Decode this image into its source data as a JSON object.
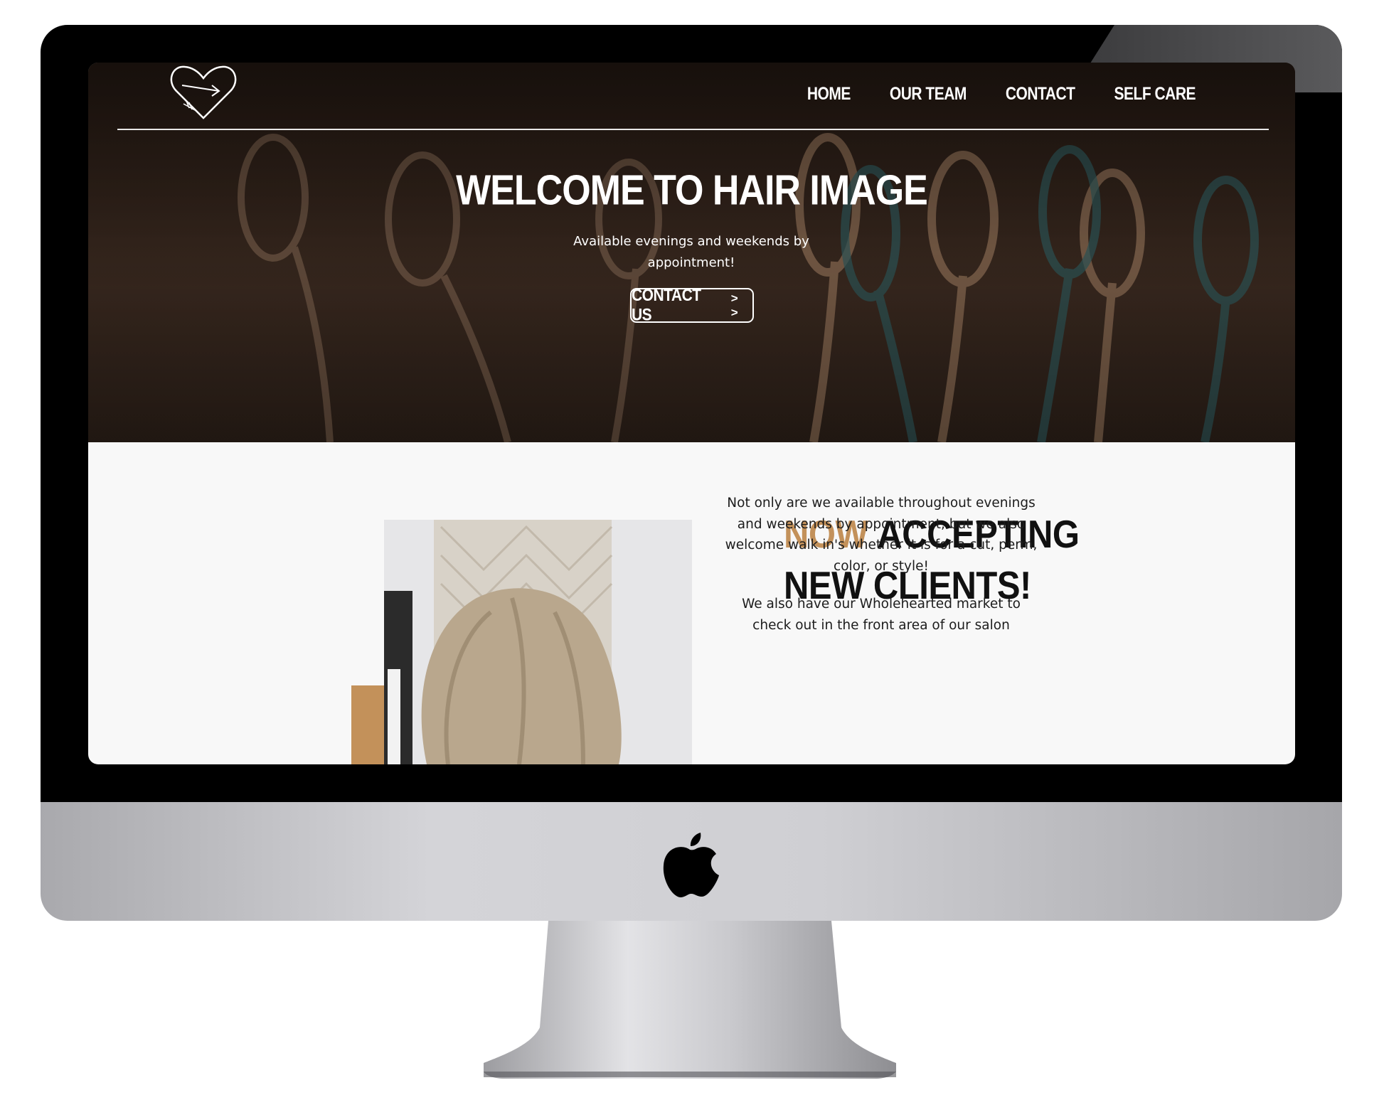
{
  "nav": {
    "items": [
      {
        "label": "HOME"
      },
      {
        "label": "OUR TEAM"
      },
      {
        "label": "CONTACT"
      },
      {
        "label": "SELF CARE"
      }
    ]
  },
  "hero": {
    "title": "WELCOME TO HAIR IMAGE",
    "subtitle": "Available evenings and weekends by appointment!",
    "cta_label": "CONTACT US",
    "cta_arrow": "> >"
  },
  "section": {
    "heading_accent": "NOW",
    "heading_rest": "ACCEPTING",
    "heading_line2": "NEW CLIENTS!",
    "paragraph1": "Not only are we available throughout evenings and weekends by appointment, but we also welcome walk in's whether it is for a cut, perm, color, or style!",
    "paragraph2": "We also have our Wholehearted market to check out in the front area of our salon"
  },
  "colors": {
    "accent": "#c3915a",
    "hero_overlay": "#2e221b",
    "page_bg": "#f8f8f8"
  },
  "icons": {
    "logo": "heart-arrow-logo-icon",
    "device_brand": "apple-icon"
  }
}
